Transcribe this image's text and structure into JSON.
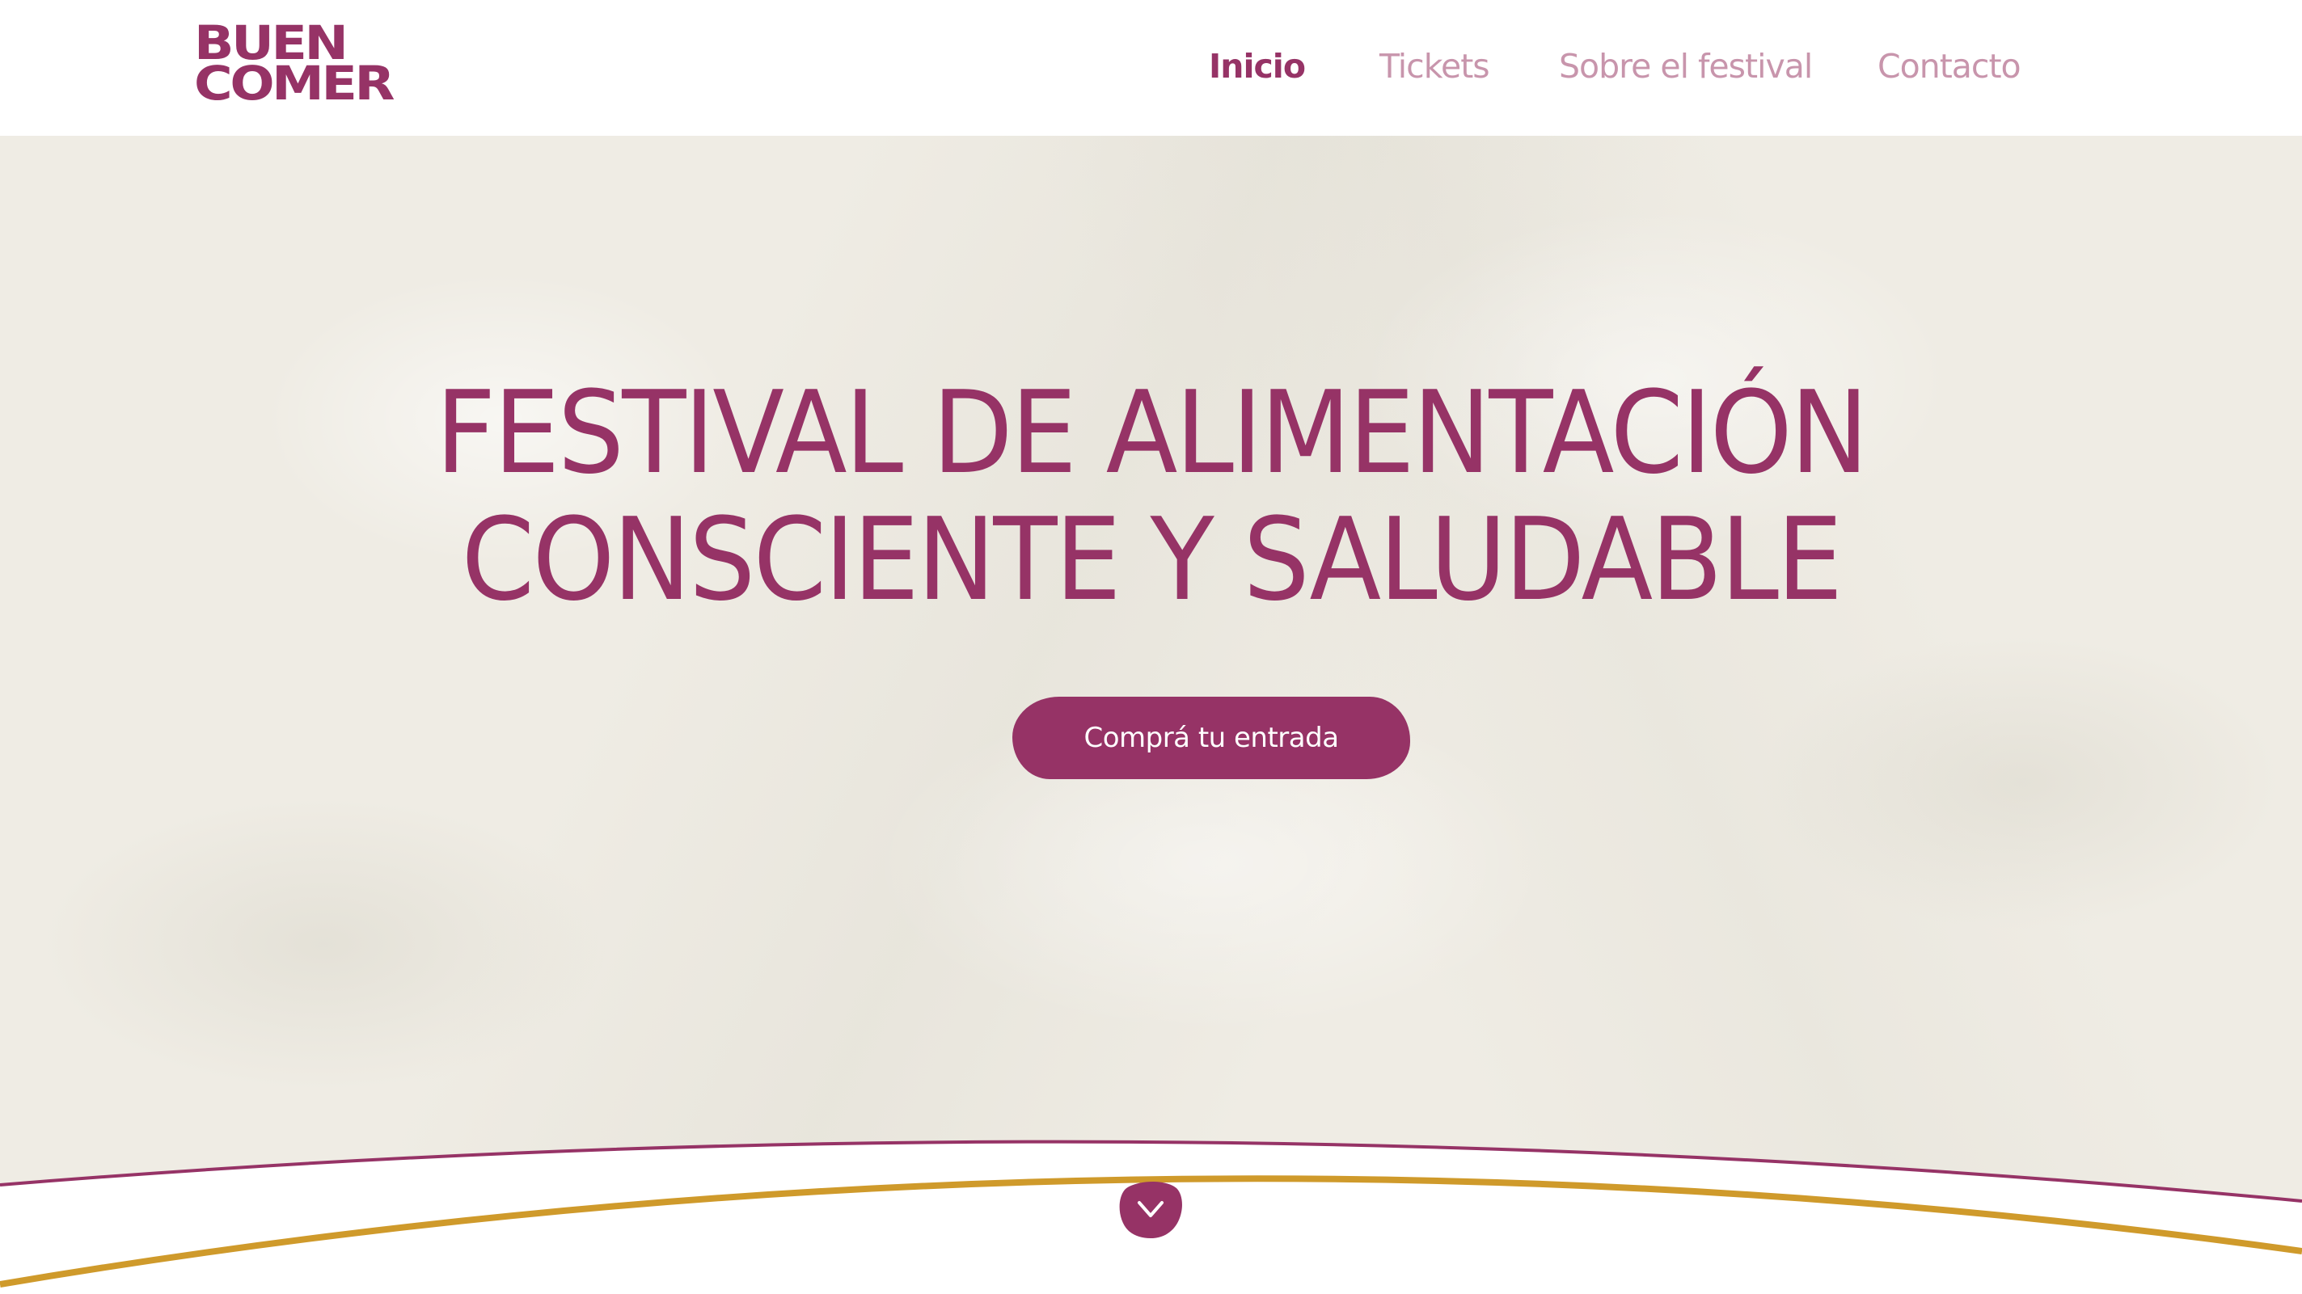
{
  "brand": {
    "logo_line1": "BUEN",
    "logo_line2": "COMER",
    "accent_color": "#963366",
    "secondary_color": "#cf9a2b",
    "nav_inactive_color": "#c895ac",
    "background_color": "#efece4"
  },
  "nav": {
    "items": [
      {
        "label": "Inicio",
        "active": true
      },
      {
        "label": "Tickets",
        "active": false
      },
      {
        "label": "Sobre el festival",
        "active": false
      },
      {
        "label": "Contacto",
        "active": false
      }
    ]
  },
  "hero": {
    "title_line1": "FESTIVAL DE ALIMENTACIÓN",
    "title_line2": "CONSCIENTE Y SALUDABLE",
    "cta_label": "Comprá tu entrada"
  },
  "scroll_button": {
    "icon": "chevron-down-icon"
  }
}
